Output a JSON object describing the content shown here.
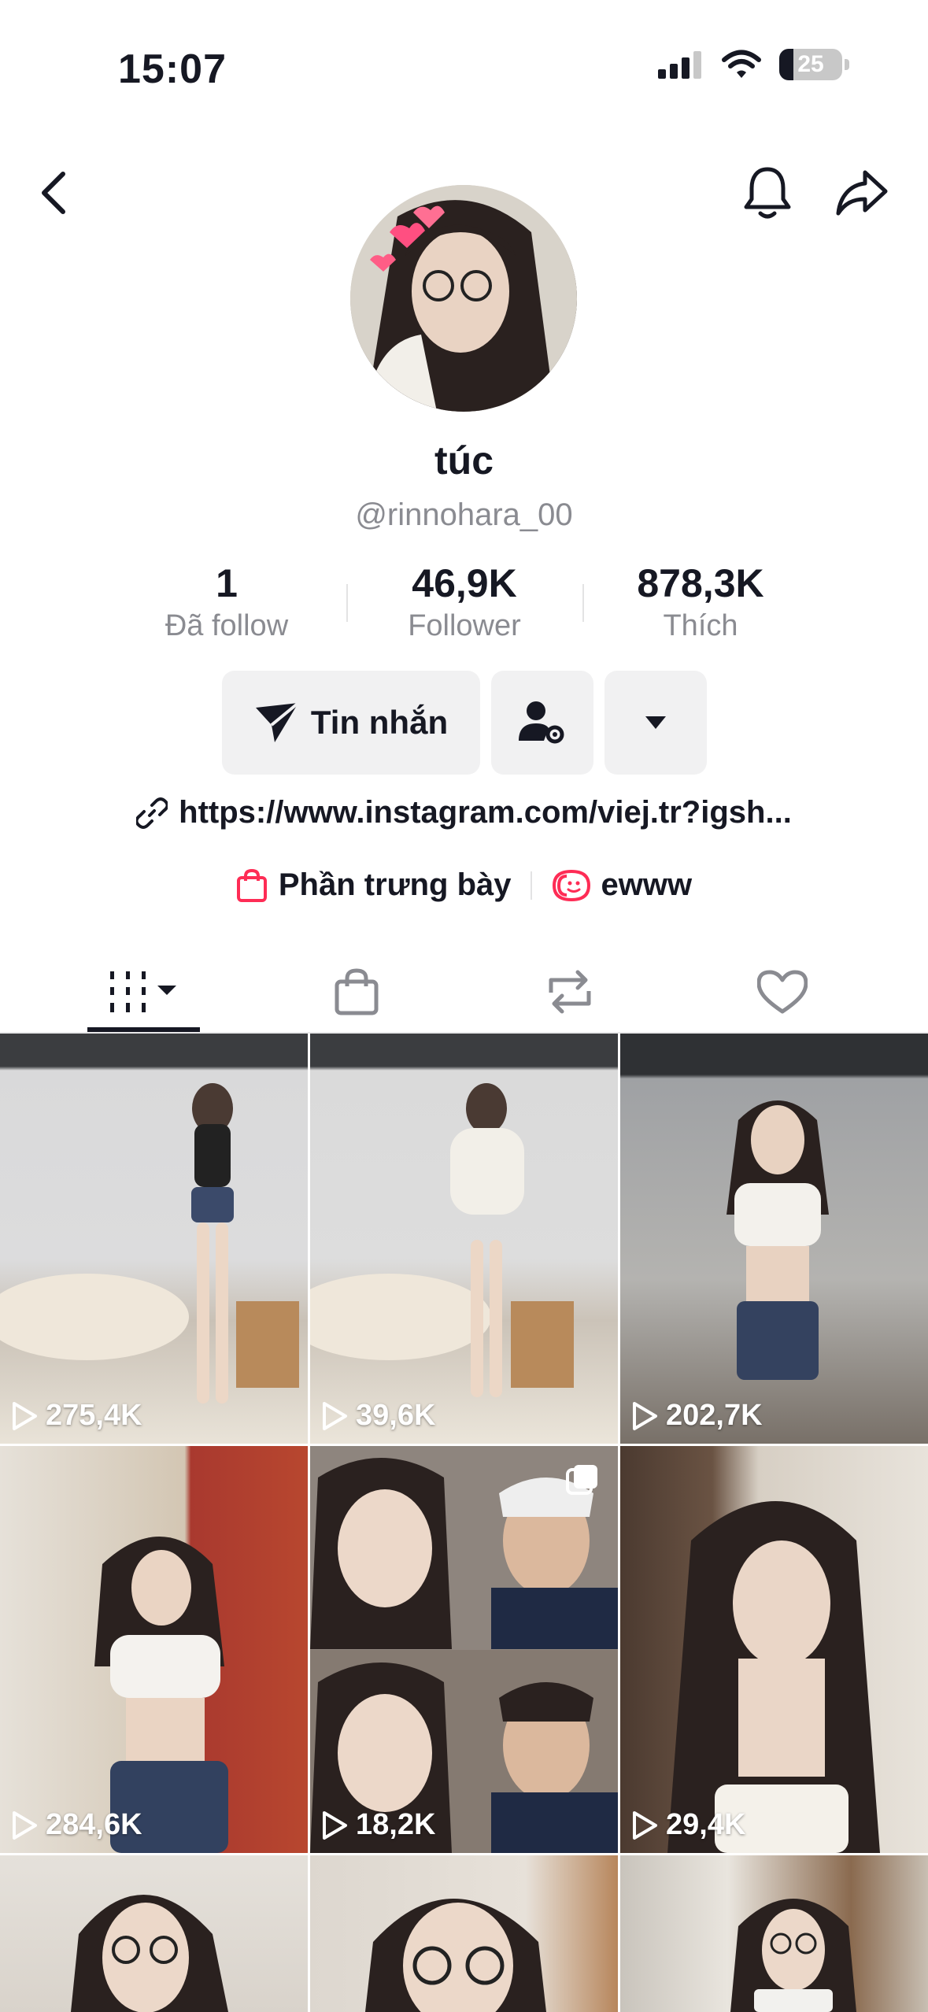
{
  "status_bar": {
    "time": "15:07",
    "battery": "25"
  },
  "profile": {
    "name": "túc",
    "handle": "@rinnohara_00",
    "stats": [
      {
        "value": "1",
        "label": "Đã follow"
      },
      {
        "value": "46,9K",
        "label": "Follower"
      },
      {
        "value": "878,3K",
        "label": "Thích"
      }
    ],
    "message_button": "Tin nhắn",
    "bio_link": "https://www.instagram.com/viej.tr?igsh...",
    "showcase_label": "Phần trưng bày",
    "playlist_label": "ewww"
  },
  "icons": {
    "back": "back-icon",
    "bell": "bell-icon",
    "share": "share-icon",
    "send": "send-icon",
    "add_friend": "add-user-settings-icon",
    "more": "caret-down-icon",
    "link": "link-icon",
    "bag": "shopping-bag-icon",
    "playlist": "playlist-icon",
    "videos_tab": "videos-grid-icon",
    "shop_tab": "shop-tab-icon",
    "repost_tab": "repost-icon",
    "liked_tab": "heart-icon"
  },
  "colors": {
    "accent": "#fe2c55",
    "text": "#161823",
    "muted": "#8a8b91",
    "button_bg": "#f1f1f2"
  },
  "videos": [
    {
      "views": "275,4K"
    },
    {
      "views": "39,6K"
    },
    {
      "views": "202,7K"
    },
    {
      "views": "284,6K"
    },
    {
      "views": "18,2K"
    },
    {
      "views": "29,4K"
    },
    {
      "views": ""
    },
    {
      "views": ""
    },
    {
      "views": ""
    }
  ]
}
